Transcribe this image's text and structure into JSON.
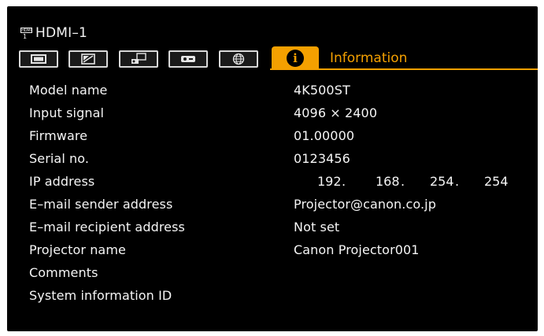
{
  "source": {
    "badge_top": "HDMI",
    "badge_num": "1",
    "label": "HDMI–1"
  },
  "tabs": [
    {
      "icon": "picture-icon"
    },
    {
      "icon": "image-adjust-icon"
    },
    {
      "icon": "installation-icon"
    },
    {
      "icon": "system-icon"
    },
    {
      "icon": "network-icon"
    }
  ],
  "active_tab": {
    "icon": "information-icon",
    "glyph": "i",
    "title": "Information"
  },
  "info": {
    "model_name": {
      "label": "Model name",
      "value": "4K500ST"
    },
    "input_signal": {
      "label": "Input signal",
      "value": "4096 × 2400"
    },
    "firmware": {
      "label": "Firmware",
      "value": "01.00000"
    },
    "serial_no": {
      "label": "Serial no.",
      "value": "0123456"
    },
    "ip_address": {
      "label": "IP address",
      "octets": [
        "192",
        "168",
        "254",
        "254"
      ]
    },
    "email_sender": {
      "label": "E–mail sender address",
      "value": "Projector@canon.co.jp"
    },
    "email_recipient": {
      "label": "E–mail recipient address",
      "value": "Not set"
    },
    "projector_name": {
      "label": "Projector name",
      "value": "Canon Projector001"
    },
    "comments": {
      "label": "Comments",
      "value": ""
    },
    "system_info_id": {
      "label": "System information ID",
      "value": ""
    }
  },
  "colors": {
    "accent": "#f4a000",
    "background": "#000000",
    "text": "#f5f5f5"
  }
}
